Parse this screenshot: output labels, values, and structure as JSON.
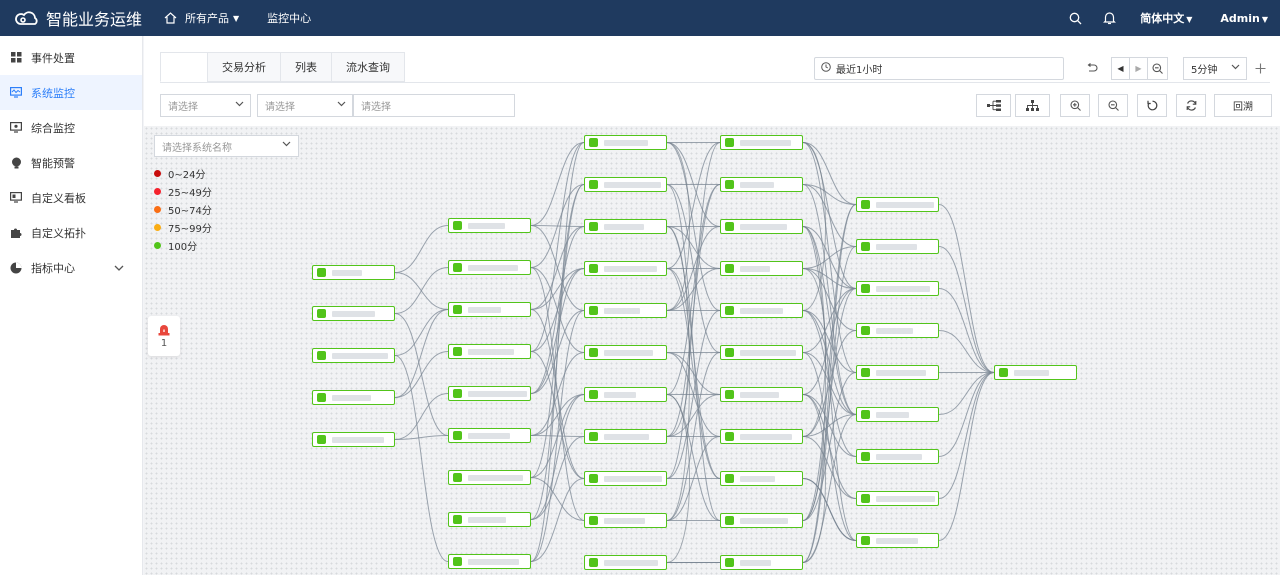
{
  "app": {
    "title": "智能业务运维"
  },
  "topnav": {
    "products": "所有产品",
    "monitor": "监控中心",
    "language": "简体中文",
    "user": "Admin"
  },
  "sidebar": {
    "items": [
      {
        "label": "事件处置",
        "icon": "grid-icon"
      },
      {
        "label": "系统监控",
        "icon": "monitor-icon"
      },
      {
        "label": "综合监控",
        "icon": "screen-icon"
      },
      {
        "label": "智能预警",
        "icon": "bulb-icon"
      },
      {
        "label": "自定义看板",
        "icon": "board-icon"
      },
      {
        "label": "自定义拓扑",
        "icon": "puzzle-icon"
      },
      {
        "label": "指标中心",
        "icon": "chart-icon"
      }
    ]
  },
  "tabs": [
    "",
    "交易分析",
    "列表",
    "流水查询"
  ],
  "time": {
    "range": "最近1小时",
    "interval": "5分钟"
  },
  "filters": {
    "select1": "请选择",
    "select2": "请选择",
    "input": "请选择"
  },
  "toolbar": {
    "back": "回溯"
  },
  "canvas": {
    "system_select": "请选择系统名称",
    "legend": [
      {
        "label": "0~24分",
        "color": "#c80c0c"
      },
      {
        "label": "25~49分",
        "color": "#f5222d"
      },
      {
        "label": "50~74分",
        "color": "#fa6e14"
      },
      {
        "label": "75~99分",
        "color": "#faad14"
      },
      {
        "label": "100分",
        "color": "#52c41a"
      }
    ],
    "alarm_count": "1"
  }
}
